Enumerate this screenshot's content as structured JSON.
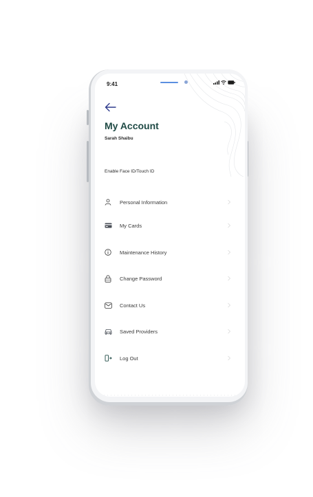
{
  "status_bar": {
    "time": "9:41"
  },
  "header": {
    "title": "My Account",
    "user_name": "Sarah Shaibu"
  },
  "settings": {
    "face_id_label": "Enable Face ID/Touch ID"
  },
  "menu": {
    "items": [
      {
        "label": "Personal Information",
        "icon": "person-icon"
      },
      {
        "label": "My Cards",
        "icon": "card-icon"
      },
      {
        "label": "Maintenance History",
        "icon": "info-icon"
      },
      {
        "label": "Change Password",
        "icon": "lock-icon"
      },
      {
        "label": "Contact Us",
        "icon": "mail-icon"
      },
      {
        "label": "Saved Providers",
        "icon": "car-icon"
      },
      {
        "label": "Log Out",
        "icon": "logout-icon"
      }
    ]
  },
  "colors": {
    "accent": "#1f4a45",
    "back_arrow": "#2d3a8c",
    "text": "#3a3a3a",
    "chevron": "#d9d9d9"
  }
}
